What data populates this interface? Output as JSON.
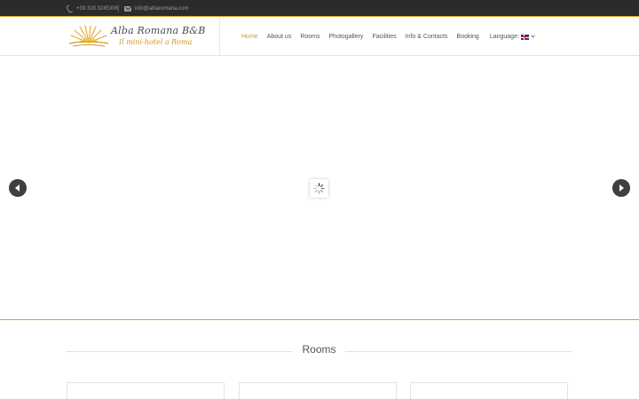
{
  "topbar": {
    "phone": "+39 328 3245308",
    "email": "info@albaromana.com"
  },
  "logo": {
    "title": "Alba Romana B&B",
    "subtitle": "Il mini-hotel a Roma"
  },
  "nav": {
    "items": [
      {
        "label": "Home",
        "active": true
      },
      {
        "label": "About us"
      },
      {
        "label": "Rooms"
      },
      {
        "label": "Photogallery"
      },
      {
        "label": "Facilities"
      },
      {
        "label": "Info & Contacts"
      },
      {
        "label": "Booking"
      }
    ],
    "language_label": "Language:"
  },
  "sections": {
    "rooms_title": "Rooms"
  },
  "colors": {
    "accent": "#d39a1e",
    "topbar_bg": "#2b2b2b",
    "arrow_bg": "#3f3f3f"
  },
  "icons": [
    "phone-icon",
    "envelope-icon",
    "uk-flag-icon",
    "chevron-down-icon",
    "chevron-left-icon",
    "chevron-right-icon",
    "loading-spinner-icon"
  ]
}
